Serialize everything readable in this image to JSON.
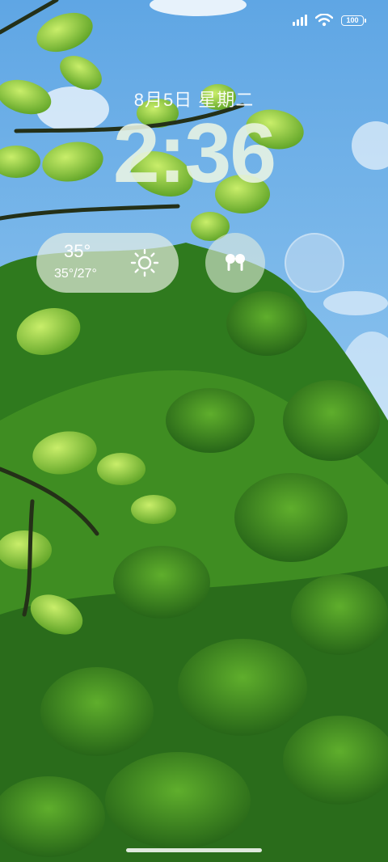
{
  "status_bar": {
    "battery_level": "100",
    "signal_bars": 4,
    "wifi": "wifi-icon"
  },
  "lockscreen": {
    "date": "8月5日 星期二",
    "time": "2:36"
  },
  "widgets": {
    "weather": {
      "temperature": "35°",
      "range": "35°/27°",
      "icon": "sun-icon"
    },
    "earbuds": {
      "icon": "earbuds-icon"
    },
    "empty": {
      "icon": "empty-circle"
    }
  },
  "colors": {
    "sky": "#6aaee6",
    "leaf_light": "#9bd84a",
    "leaf_dark": "#1f5a18"
  }
}
